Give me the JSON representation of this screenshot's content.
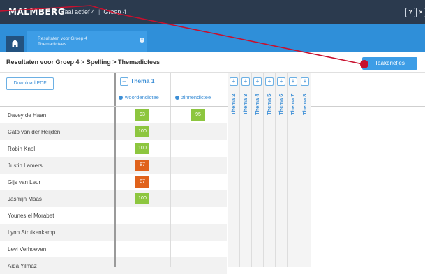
{
  "header": {
    "logo": "MALMBERG",
    "nav_item_1": "Taal actief 4",
    "nav_sep": "|",
    "nav_item_2": "Groep 4",
    "help_label": "?",
    "close_label": "×"
  },
  "tab": {
    "line1": "Resultaten voor Groep 4",
    "line2": "Themadictees",
    "close_label": "×"
  },
  "page": {
    "breadcrumb": "Resultaten voor Groep 4 > Spelling > Themadictees",
    "taakbriefjes_label": "Taakbriefjes",
    "download_label": "Download PDF"
  },
  "thema1": {
    "label": "Thema 1",
    "toggle": "–",
    "col1": "woordendictee",
    "col2": "zinnendictee"
  },
  "themes": [
    {
      "label": "Thema 2",
      "toggle": "+"
    },
    {
      "label": "Thema 3",
      "toggle": "+"
    },
    {
      "label": "Thema 4",
      "toggle": "+"
    },
    {
      "label": "Thema 5",
      "toggle": "+"
    },
    {
      "label": "Thema 6",
      "toggle": "+"
    },
    {
      "label": "Thema 7",
      "toggle": "+"
    },
    {
      "label": "Thema 8",
      "toggle": "+"
    }
  ],
  "students": [
    {
      "name": "Davey de Haan",
      "woorden": "93",
      "zinnen": "95"
    },
    {
      "name": "Cato van der Heijden",
      "woorden": "100",
      "zinnen": ""
    },
    {
      "name": "Robin Knol",
      "woorden": "100",
      "zinnen": ""
    },
    {
      "name": "Justin Lamers",
      "woorden": "87",
      "zinnen": ""
    },
    {
      "name": "Gijs van Leur",
      "woorden": "87",
      "zinnen": ""
    },
    {
      "name": "Jasmijn Maas",
      "woorden": "100",
      "zinnen": ""
    },
    {
      "name": "Younes el Morabet",
      "woorden": "",
      "zinnen": ""
    },
    {
      "name": "Lynn Struikenkamp",
      "woorden": "",
      "zinnen": ""
    },
    {
      "name": "Levi Verhoeven",
      "woorden": "",
      "zinnen": ""
    },
    {
      "name": "Aida Yilmaz",
      "woorden": "",
      "zinnen": ""
    }
  ],
  "colors": {
    "topbar": "#2b3a4e",
    "accent": "#3d9de6",
    "score_high": "#8dc63f",
    "score_low": "#e0621b",
    "annotation": "#c8102e"
  },
  "score_levels": {
    "93": "green",
    "95": "green",
    "100": "green",
    "87": "orange"
  }
}
